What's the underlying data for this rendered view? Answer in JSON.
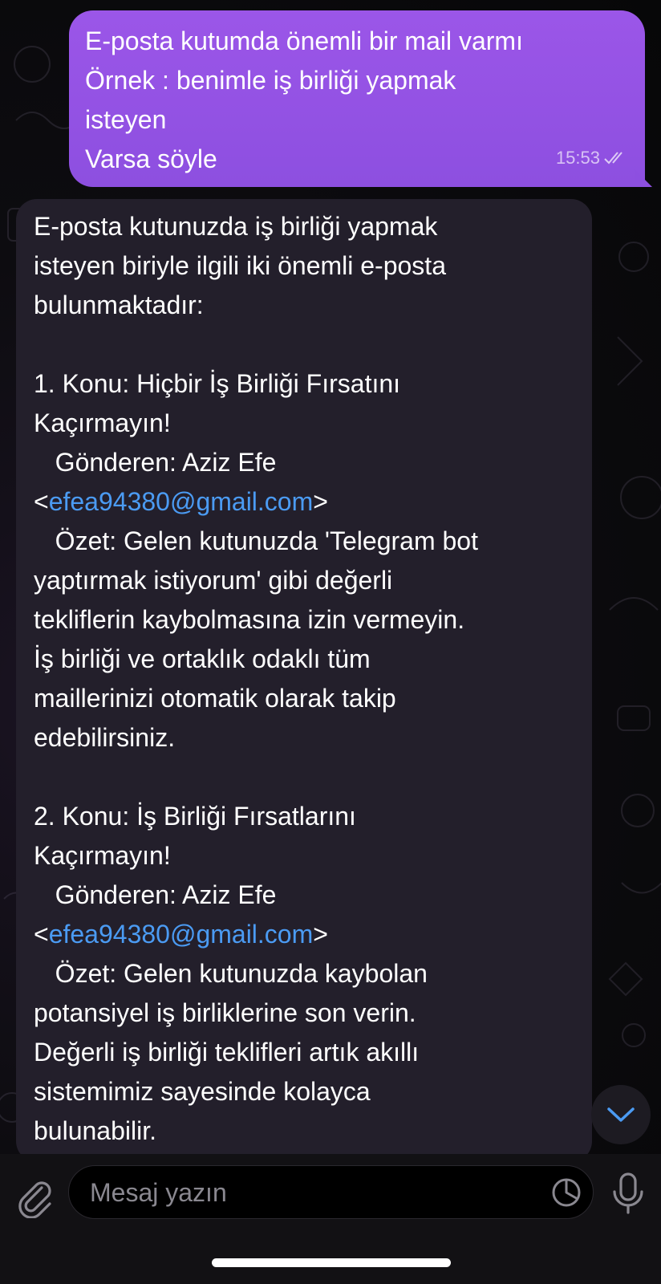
{
  "outgoing": {
    "lines": [
      "E-posta kutumda önemli bir mail varmı",
      "Örnek : benimle iş birliği yapmak",
      "isteyen",
      "Varsa söyle"
    ],
    "time": "15:53",
    "status_icon": "double-check-icon"
  },
  "incoming": {
    "intro": [
      "E-posta kutunuzda iş birliği yapmak",
      "isteyen biriyle ilgili iki önemli e-posta",
      "bulunmaktadır:"
    ],
    "emails": [
      {
        "subject_lines": [
          "1. Konu: Hiçbir İş Birliği Fırsatını",
          "Kaçırmayın!"
        ],
        "sender": "   Gönderen: Aziz Efe",
        "address_open": "<",
        "address": "efea94380@gmail.com",
        "address_close": ">",
        "summary_lines": [
          "   Özet: Gelen kutunuzda 'Telegram bot",
          "yaptırmak istiyorum' gibi değerli",
          "tekliflerin kaybolmasına izin vermeyin.",
          "İş birliği ve ortaklık odaklı tüm",
          "maillerinizi otomatik olarak takip",
          "edebilirsiniz."
        ]
      },
      {
        "subject_lines": [
          "2. Konu: İş Birliği Fırsatlarını",
          "Kaçırmayın!"
        ],
        "sender": "   Gönderen: Aziz Efe",
        "address_open": "<",
        "address": "efea94380@gmail.com",
        "address_close": ">",
        "summary_lines": [
          "   Özet: Gelen kutunuzda kaybolan",
          "potansiyel iş birliklerine son verin.",
          "Değerli iş birliği teklifleri artık akıllı",
          "sistemimiz sayesinde kolayca",
          "bulunabilir."
        ]
      }
    ]
  },
  "composer": {
    "placeholder": "Mesaj yazın",
    "attach_icon": "paperclip-icon",
    "sticker_icon": "sticker-icon",
    "mic_icon": "microphone-icon"
  },
  "scroll_down_icon": "chevron-down-icon",
  "colors": {
    "outgoing_bubble": "#9b56e8",
    "incoming_bubble": "#231f2b",
    "link": "#4b9bf3",
    "accent": "#4b9bf3"
  }
}
